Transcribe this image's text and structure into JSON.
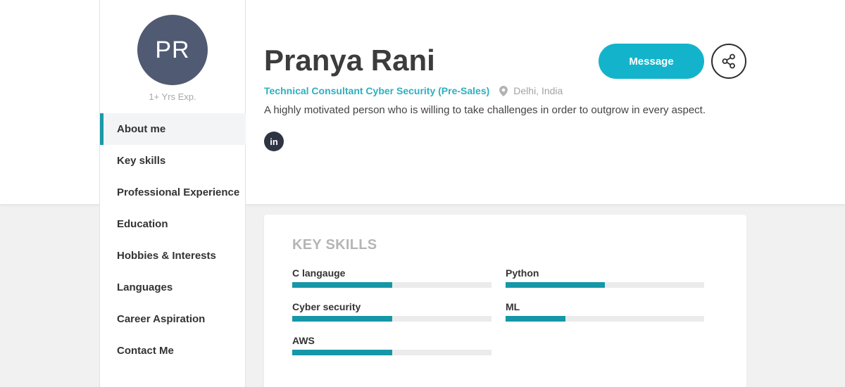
{
  "profile": {
    "initials": "PR",
    "experience": "1+ Yrs Exp.",
    "name": "Pranya Rani",
    "role": "Technical Consultant Cyber Security (Pre-Sales)",
    "location": "Delhi, India",
    "bio": "A highly motivated person who is willing to take challenges in order to outgrow in every aspect.",
    "social_label": "in"
  },
  "actions": {
    "message_label": "Message"
  },
  "sidebar": {
    "items": [
      {
        "label": "About me",
        "active": true
      },
      {
        "label": "Key skills"
      },
      {
        "label": "Professional Experience"
      },
      {
        "label": "Education"
      },
      {
        "label": "Hobbies & Interests"
      },
      {
        "label": "Languages"
      },
      {
        "label": "Career Aspiration"
      },
      {
        "label": "Contact Me"
      }
    ]
  },
  "key_skills": {
    "title": "KEY SKILLS",
    "skills": [
      {
        "name": "C langauge",
        "level": 0.5
      },
      {
        "name": "Python",
        "level": 0.5
      },
      {
        "name": "Cyber security",
        "level": 0.5
      },
      {
        "name": "ML",
        "level": 0.3
      },
      {
        "name": "AWS",
        "level": 0.5
      }
    ]
  },
  "colors": {
    "accent": "#13b4cb",
    "avatar": "#505a73",
    "skill_bar": "#1597a8"
  }
}
